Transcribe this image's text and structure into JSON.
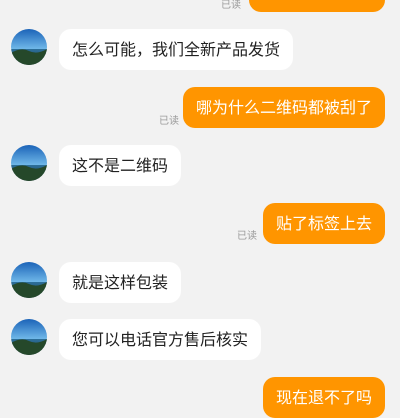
{
  "messages": [
    {
      "side": "out",
      "text": "",
      "read": "已读"
    },
    {
      "side": "in",
      "text": "怎么可能，我们全新产品发货"
    },
    {
      "side": "out",
      "text": "哪为什么二维码都被刮了",
      "read": "已读"
    },
    {
      "side": "in",
      "text": "这不是二维码"
    },
    {
      "side": "out",
      "text": "贴了标签上去",
      "read": "已读"
    },
    {
      "side": "in",
      "text": "就是这样包装"
    },
    {
      "side": "in",
      "text": "您可以电话官方售后核实"
    },
    {
      "side": "out",
      "text": "现在退不了吗"
    }
  ],
  "colors": {
    "outgoing_bubble": "#ff9500",
    "incoming_bubble": "#ffffff",
    "background": "#f2f2f2"
  },
  "icons": {
    "avatar": "seller-avatar-icon"
  }
}
